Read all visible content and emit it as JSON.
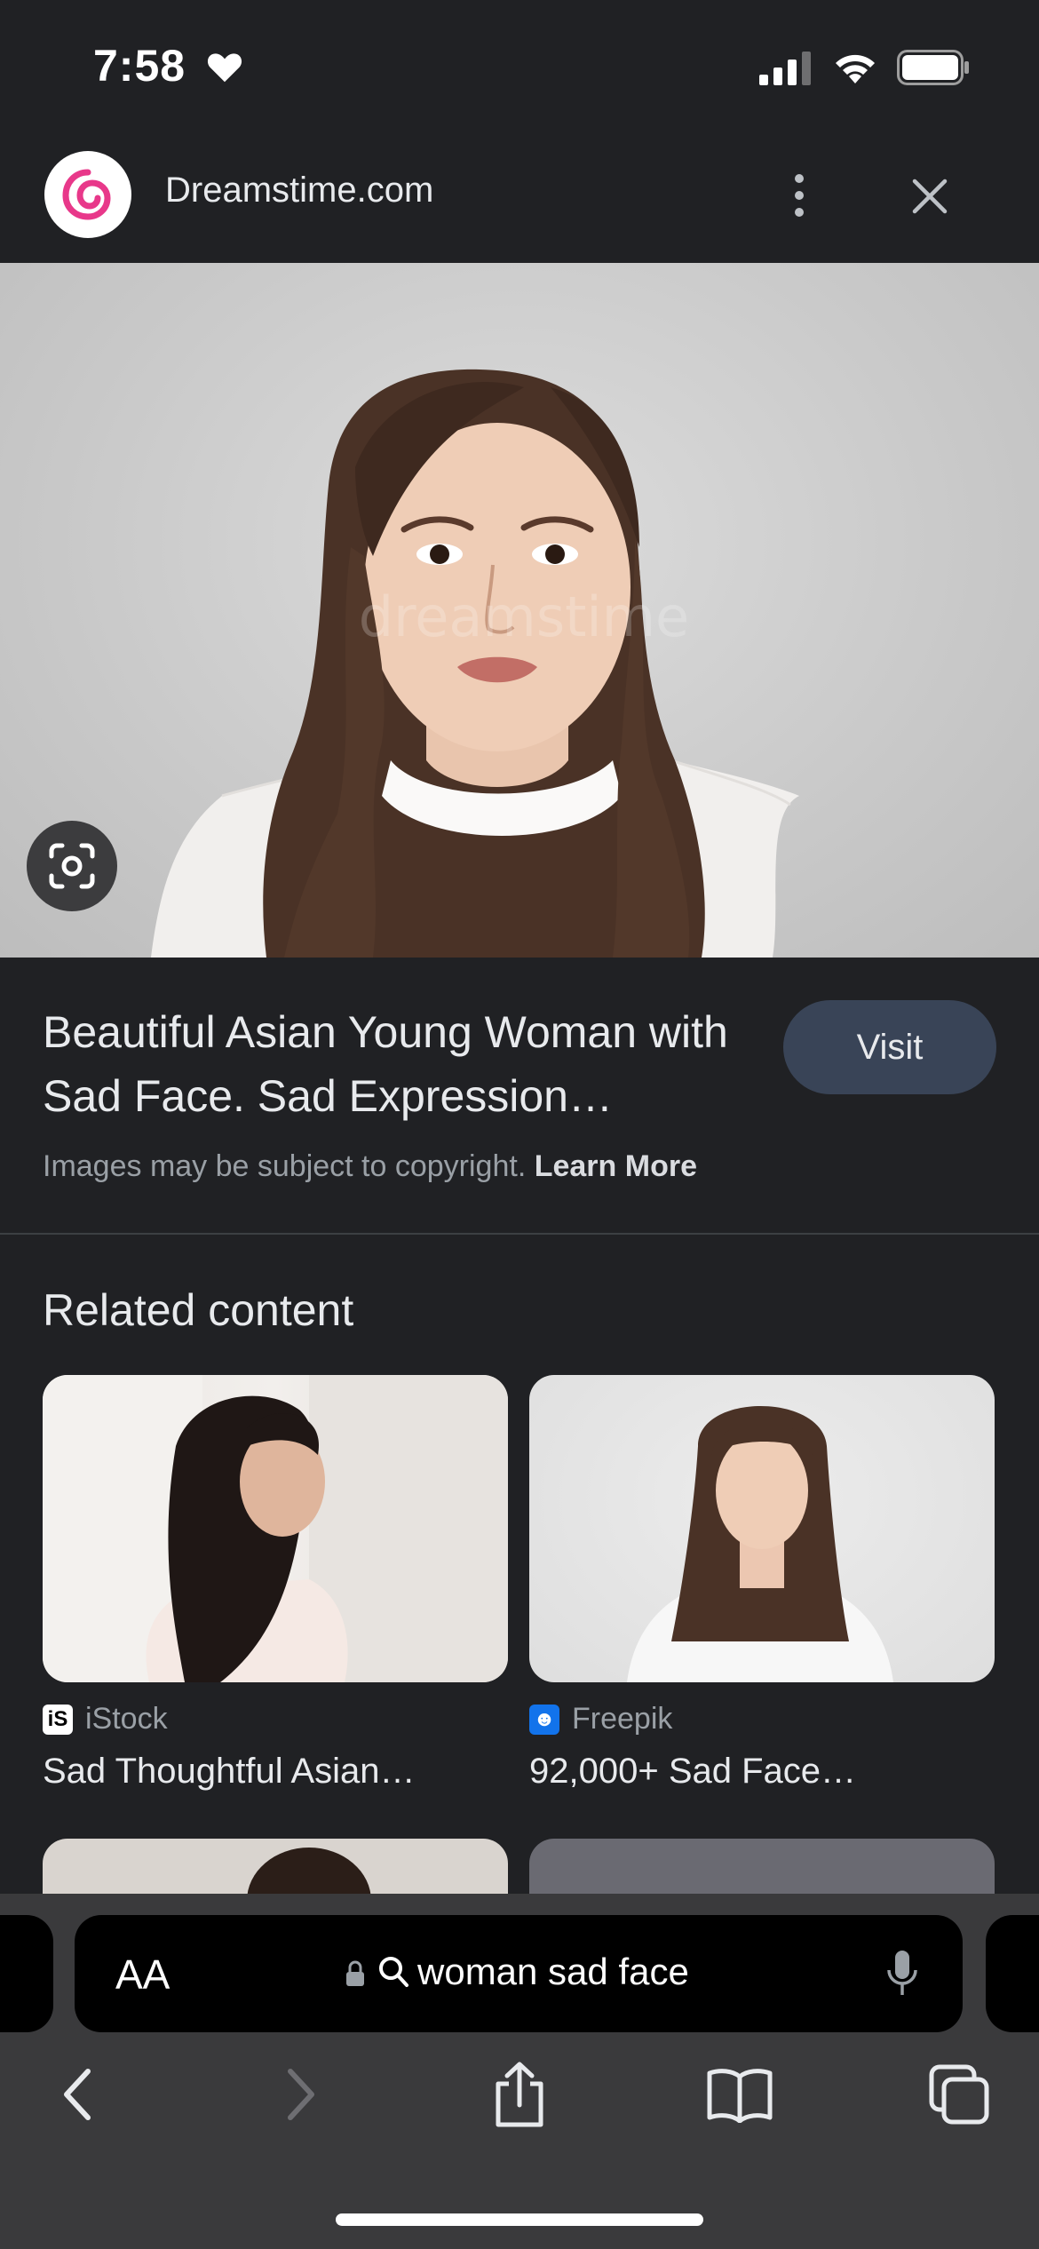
{
  "status_bar": {
    "time": "7:58"
  },
  "header": {
    "site_name": "Dreamstime.com"
  },
  "result": {
    "title": "Beautiful Asian Young Woman with Sad Face. Sad Expression…",
    "visit_label": "Visit",
    "copyright_text": "Images may be subject to copyright.",
    "learn_more": "Learn More",
    "watermark": "dreamstime"
  },
  "related": {
    "heading": "Related content",
    "items": [
      {
        "source": "iStock",
        "caption": "Sad Thoughtful Asian…",
        "icon": "istock-icon"
      },
      {
        "source": "Freepik",
        "caption": "92,000+ Sad Face…",
        "icon": "freepik-icon"
      }
    ]
  },
  "address_bar": {
    "text_size_label": "AA",
    "url": "woman sad face"
  },
  "colors": {
    "background": "#202124",
    "visit_button": "#394457",
    "toolbar": "#3a3a3c",
    "brand_pink": "#e8388a"
  }
}
